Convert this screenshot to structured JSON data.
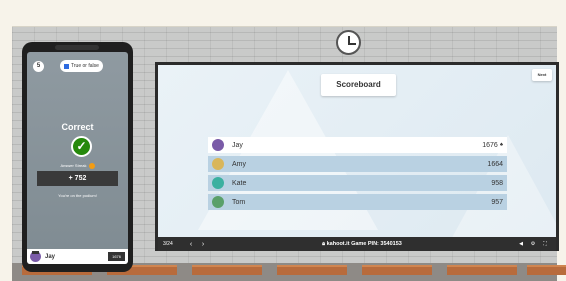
{
  "phone": {
    "question_number": "5",
    "question_type": "True or false",
    "result_title": "Correct",
    "streak_label": "Answer Streak",
    "points_gained": "+ 752",
    "podium_message": "You're on the podium!",
    "player_name": "Jay",
    "player_score": "1676"
  },
  "screen": {
    "title": "Scoreboard",
    "next_label": "Next",
    "rows": [
      {
        "name": "Jay",
        "score": "1676",
        "avatar_color": "#7a5ba8"
      },
      {
        "name": "Amy",
        "score": "1664",
        "avatar_color": "#d9b65a"
      },
      {
        "name": "Kate",
        "score": "958",
        "avatar_color": "#3bb0a0"
      },
      {
        "name": "Tom",
        "score": "957",
        "avatar_color": "#5aa06a"
      }
    ],
    "bottom_bar": {
      "counter": "3/24",
      "site": "kahoot.it",
      "pin_label": "Game PIN:",
      "pin": "3540153"
    }
  }
}
